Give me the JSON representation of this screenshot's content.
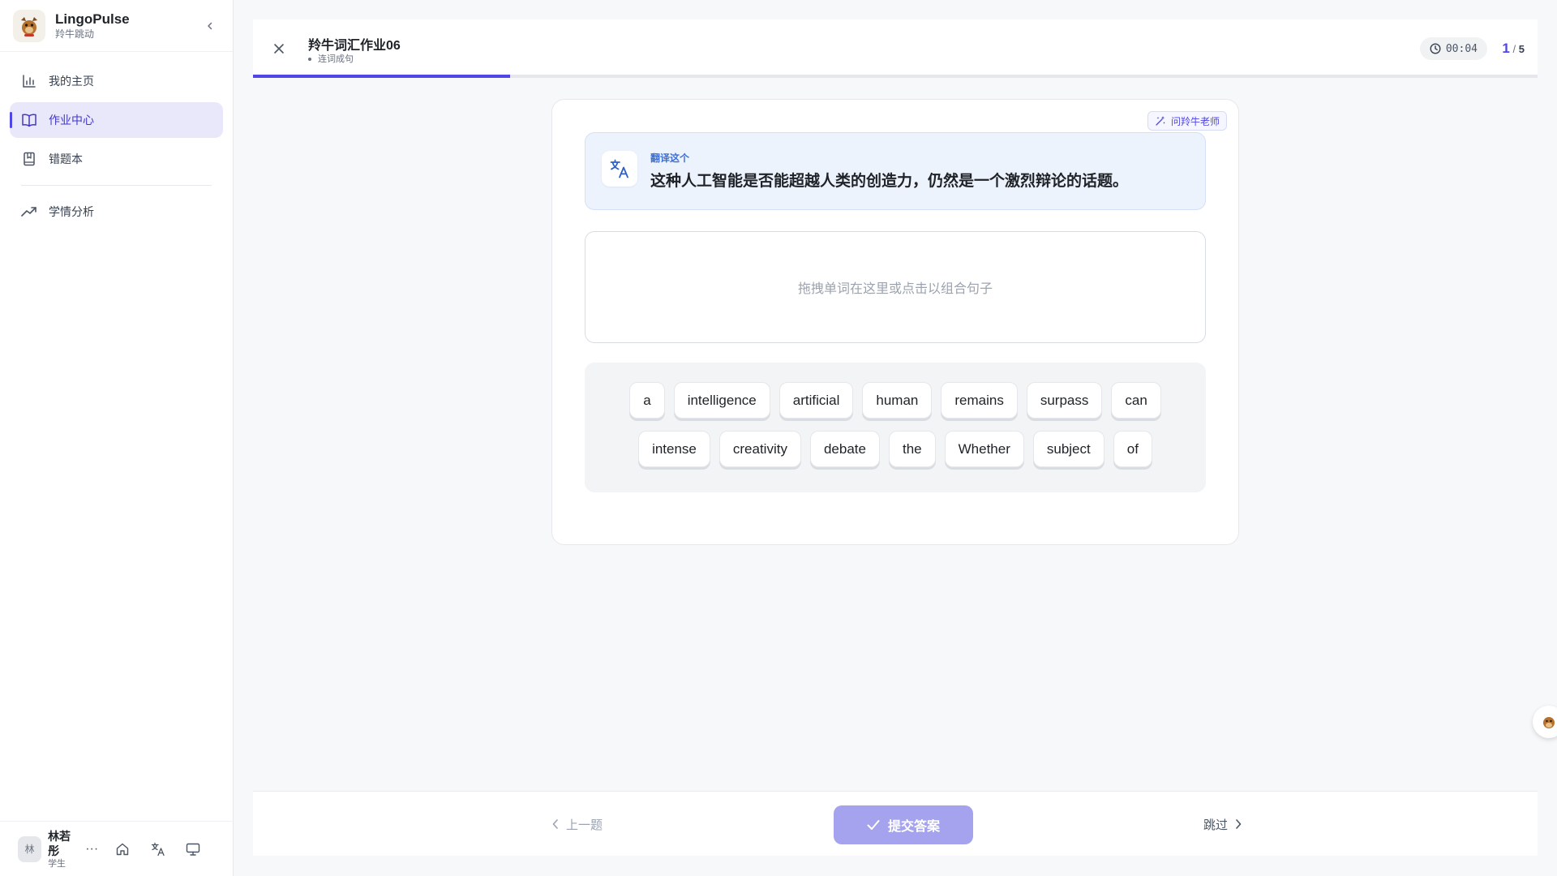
{
  "brand": {
    "name": "LingoPulse",
    "subtitle": "羚牛跳动"
  },
  "sidebar": {
    "items": [
      {
        "label": "我的主页",
        "icon": "bar-chart-icon"
      },
      {
        "label": "作业中心",
        "icon": "open-book-icon",
        "active": true
      },
      {
        "label": "错题本",
        "icon": "bookmark-book-icon"
      },
      {
        "label": "学情分析",
        "icon": "trending-up-icon"
      }
    ]
  },
  "user": {
    "avatar_initial": "林",
    "name": "林若彤",
    "role": "学生",
    "more": "···"
  },
  "header": {
    "title": "羚牛词汇作业06",
    "subtitle": "连词成句",
    "timer": "00:04",
    "current": "1",
    "separator": "/",
    "total": "5",
    "progress_fraction": 0.2
  },
  "card": {
    "ask_teacher": "问羚牛老师",
    "prompt_label": "翻译这个",
    "prompt_text": "这种人工智能是否能超越人类的创造力，仍然是一个激烈辩论的话题。",
    "dropzone_placeholder": "拖拽单词在这里或点击以组合句子",
    "words_row1": [
      "a",
      "intelligence",
      "artificial",
      "human",
      "remains",
      "surpass",
      "can"
    ],
    "words_row2": [
      "intense",
      "creativity",
      "debate",
      "the",
      "Whether",
      "subject",
      "of"
    ]
  },
  "footer": {
    "prev": "上一题",
    "submit": "提交答案",
    "skip": "跳过"
  },
  "colors": {
    "accent": "#4f46e5",
    "submit_disabled": "#a5a3ee",
    "prompt_bg": "#edf3fd"
  }
}
